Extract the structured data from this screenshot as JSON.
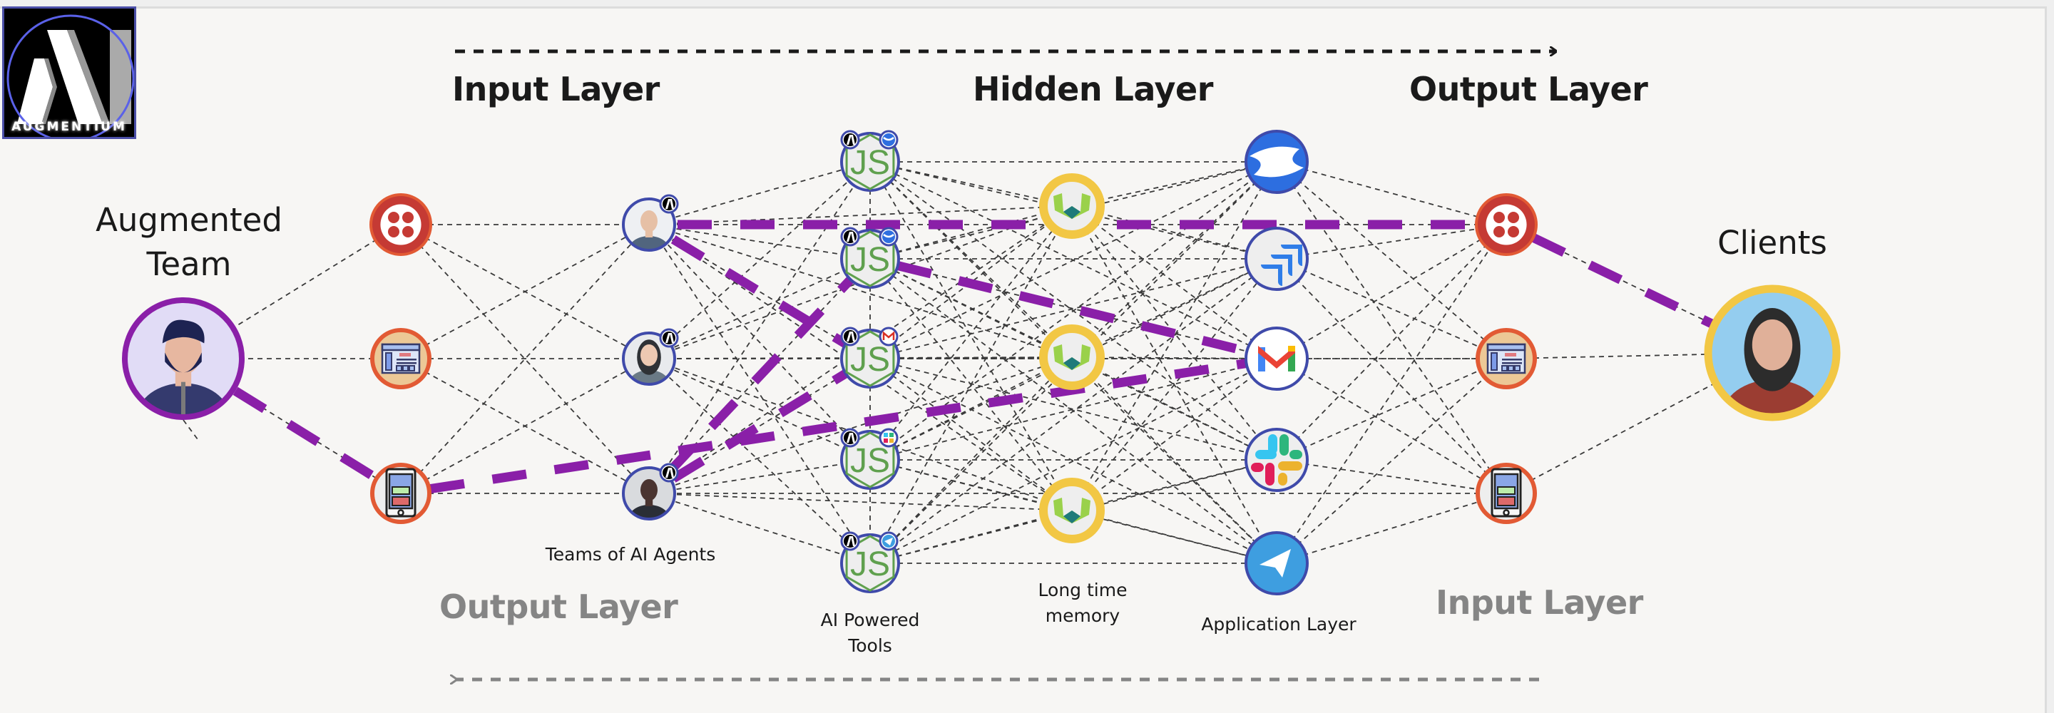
{
  "brand": {
    "name": "AUGMENTIUM",
    "ring_color": "#5a61e8"
  },
  "colors": {
    "highlight_path": "#8a1fa8",
    "connection": "#3a3a3a",
    "agent_ring": "#3f4aaa",
    "channel_ring": "#e25a34",
    "memory_ring": "#f2c744",
    "team_ring": "#8a1fa8",
    "client_ring": "#f2c744",
    "header_dark": "#1a1a1a",
    "header_gray": "#858585"
  },
  "top_flow": {
    "direction": "left-to-right",
    "headers": [
      "Input Layer",
      "Hidden Layer",
      "Output Layer"
    ]
  },
  "bottom_flow": {
    "direction": "right-to-left",
    "headers": [
      "Output Layer",
      "Input Layer"
    ]
  },
  "labels": {
    "team": [
      "Augmented",
      "Team"
    ],
    "clients": "Clients",
    "agents": "Teams of AI Agents",
    "tools": [
      "AI Powered",
      "Tools"
    ],
    "memory": [
      "Long time",
      "memory"
    ],
    "apps": "Application Layer"
  },
  "nodes": {
    "team": {
      "id": "team",
      "name": "augmented-team-member",
      "icon": "bearded-man-avatar"
    },
    "client": {
      "id": "client",
      "name": "client",
      "icon": "woman-avatar"
    },
    "channels_in": [
      {
        "id": "ch_in_1",
        "icon": "twilio-icon"
      },
      {
        "id": "ch_in_2",
        "icon": "web-page-icon"
      },
      {
        "id": "ch_in_3",
        "icon": "mobile-app-icon"
      }
    ],
    "agents": [
      {
        "id": "ag1",
        "icon": "male-ai-agent-avatar",
        "badge": "augmentium-badge"
      },
      {
        "id": "ag2",
        "icon": "female-ai-agent-avatar",
        "badge": "augmentium-badge"
      },
      {
        "id": "ag3",
        "icon": "dark-female-ai-agent-avatar",
        "badge": "augmentium-badge"
      }
    ],
    "tools": [
      {
        "id": "t1",
        "icon": "nodejs-icon",
        "badges": [
          "augmentium-badge",
          "confluence-badge"
        ]
      },
      {
        "id": "t2",
        "icon": "nodejs-icon",
        "badges": [
          "augmentium-badge",
          "jira-badge"
        ]
      },
      {
        "id": "t3",
        "icon": "nodejs-icon",
        "badges": [
          "augmentium-badge",
          "gmail-badge"
        ]
      },
      {
        "id": "t4",
        "icon": "nodejs-icon",
        "badges": [
          "augmentium-badge",
          "slack-badge"
        ]
      },
      {
        "id": "t5",
        "icon": "nodejs-icon",
        "badges": [
          "augmentium-badge",
          "telegram-badge"
        ]
      }
    ],
    "memory": [
      {
        "id": "m1",
        "icon": "weaviate-icon"
      },
      {
        "id": "m2",
        "icon": "weaviate-icon"
      },
      {
        "id": "m3",
        "icon": "weaviate-icon"
      }
    ],
    "apps": [
      {
        "id": "a1",
        "icon": "confluence-icon"
      },
      {
        "id": "a2",
        "icon": "jira-icon"
      },
      {
        "id": "a3",
        "icon": "gmail-icon"
      },
      {
        "id": "a4",
        "icon": "slack-icon"
      },
      {
        "id": "a5",
        "icon": "telegram-icon"
      }
    ],
    "channels_out": [
      {
        "id": "ch_out_1",
        "icon": "twilio-icon"
      },
      {
        "id": "ch_out_2",
        "icon": "web-page-icon"
      },
      {
        "id": "ch_out_3",
        "icon": "mobile-app-icon"
      }
    ]
  },
  "highlight_path": [
    [
      "team",
      "ch_in_3"
    ],
    [
      "ch_in_3",
      "a3"
    ],
    [
      "ag3",
      "t2"
    ],
    [
      "ag3",
      "t3"
    ],
    [
      "ag1",
      "t3"
    ],
    [
      "ag1",
      "ch_out_1"
    ],
    [
      "t2",
      "a3"
    ],
    [
      "ch_out_1",
      "client"
    ]
  ]
}
